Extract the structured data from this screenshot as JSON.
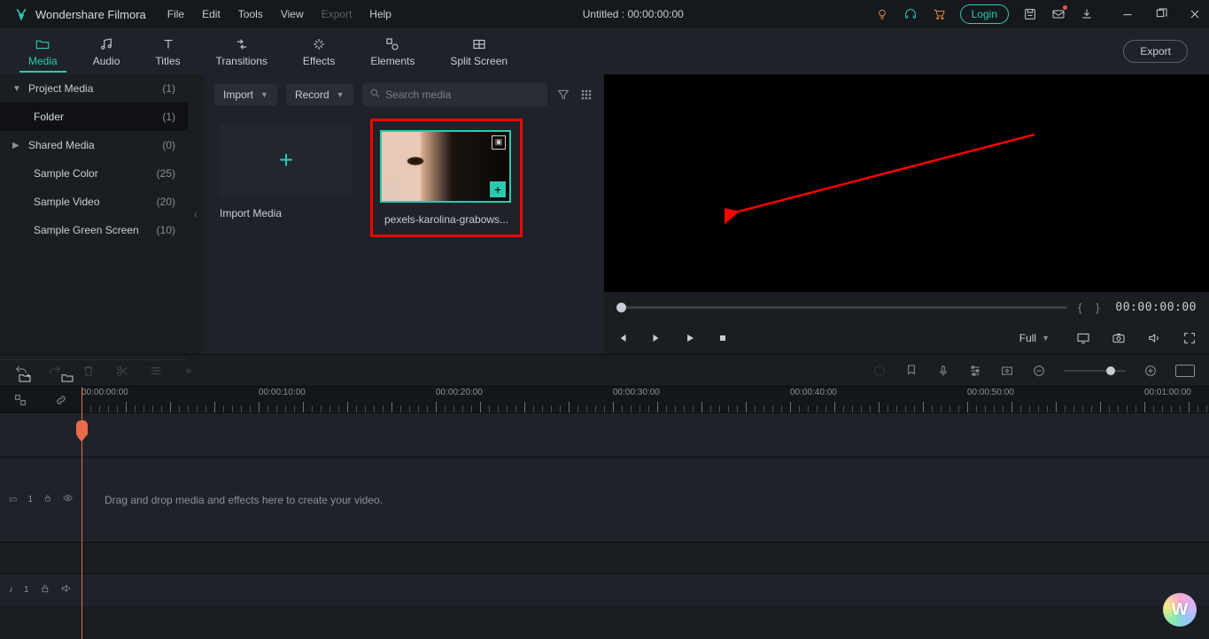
{
  "title": {
    "app_name": "Wondershare Filmora",
    "project": "Untitled : 00:00:00:00"
  },
  "menu": {
    "file": "File",
    "edit": "Edit",
    "tools": "Tools",
    "view": "View",
    "export": "Export",
    "help": "Help"
  },
  "titlebar": {
    "login": "Login"
  },
  "tabs": {
    "media": "Media",
    "audio": "Audio",
    "titles": "Titles",
    "transitions": "Transitions",
    "effects": "Effects",
    "elements": "Elements",
    "split": "Split Screen",
    "export_btn": "Export"
  },
  "sidebar": {
    "items": [
      {
        "label": "Project Media",
        "count": "(1)"
      },
      {
        "label": "Folder",
        "count": "(1)"
      },
      {
        "label": "Shared Media",
        "count": "(0)"
      },
      {
        "label": "Sample Color",
        "count": "(25)"
      },
      {
        "label": "Sample Video",
        "count": "(20)"
      },
      {
        "label": "Sample Green Screen",
        "count": "(10)"
      }
    ]
  },
  "media_panel": {
    "import": "Import",
    "record": "Record",
    "search_ph": "Search media",
    "import_tile": "Import Media",
    "clip_name": "pexels-karolina-grabows..."
  },
  "preview": {
    "time": "00:00:00:00",
    "fit": "Full"
  },
  "timeline": {
    "ruler": [
      "00:00:00:00",
      "00:00:10:00",
      "00:00:20:00",
      "00:00:30:00",
      "00:00:40:00",
      "00:00:50:00",
      "00:01:00:00"
    ],
    "editor_track": "1",
    "audio_track": "1",
    "dropzone": "Drag and drop media and effects here to create your video."
  }
}
